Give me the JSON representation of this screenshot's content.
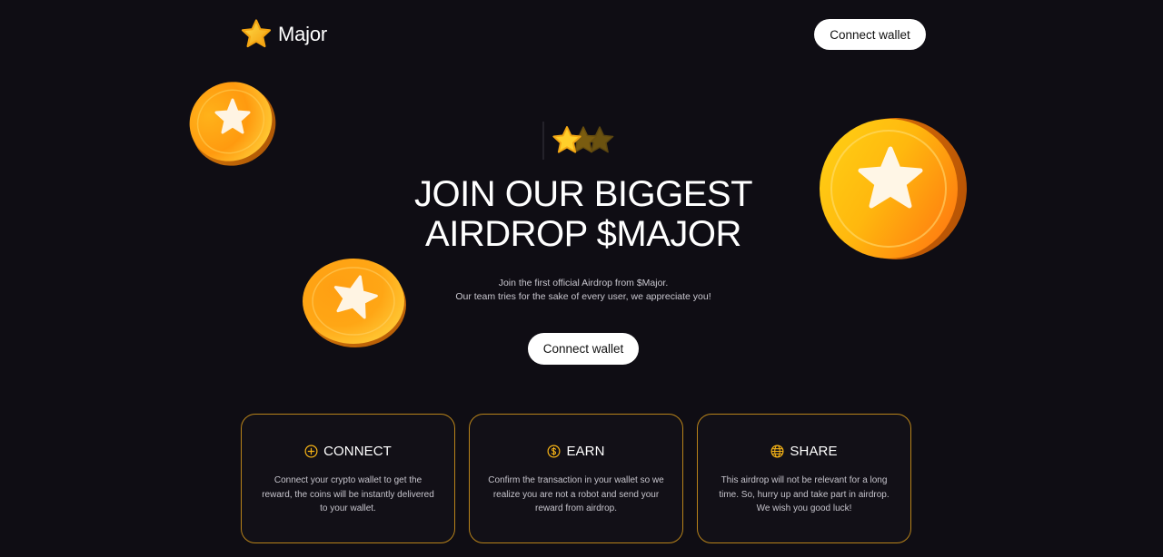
{
  "header": {
    "logo_text": "Major",
    "connect_label": "Connect wallet"
  },
  "hero": {
    "title_line1": "JOIN OUR BIGGEST",
    "title_line2": "AIRDROP $MAJOR",
    "subtitle_line1": "Join the first official Airdrop from $Major.",
    "subtitle_line2": "Our team tries for the sake of every user, we appreciate you!",
    "connect_label": "Connect wallet",
    "rating_stars_filled": 1,
    "rating_stars_total": 3
  },
  "cards": [
    {
      "icon": "plus-circle-icon",
      "title": "CONNECT",
      "text": "Connect your crypto wallet to get the reward, the coins will be instantly delivered to your wallet."
    },
    {
      "icon": "dollar-circle-icon",
      "title": "EARN",
      "text": "Confirm the transaction in your wallet so we realize you are not a robot and send your reward from airdrop."
    },
    {
      "icon": "globe-icon",
      "title": "SHARE",
      "text": "This airdrop will not be relevant for a long time. So, hurry up and take part in airdrop. We wish you good luck!"
    }
  ],
  "colors": {
    "background": "#0f0d14",
    "accent_gold": "#f5b316",
    "card_border": "#b8831a",
    "button_bg": "#ffffff"
  }
}
